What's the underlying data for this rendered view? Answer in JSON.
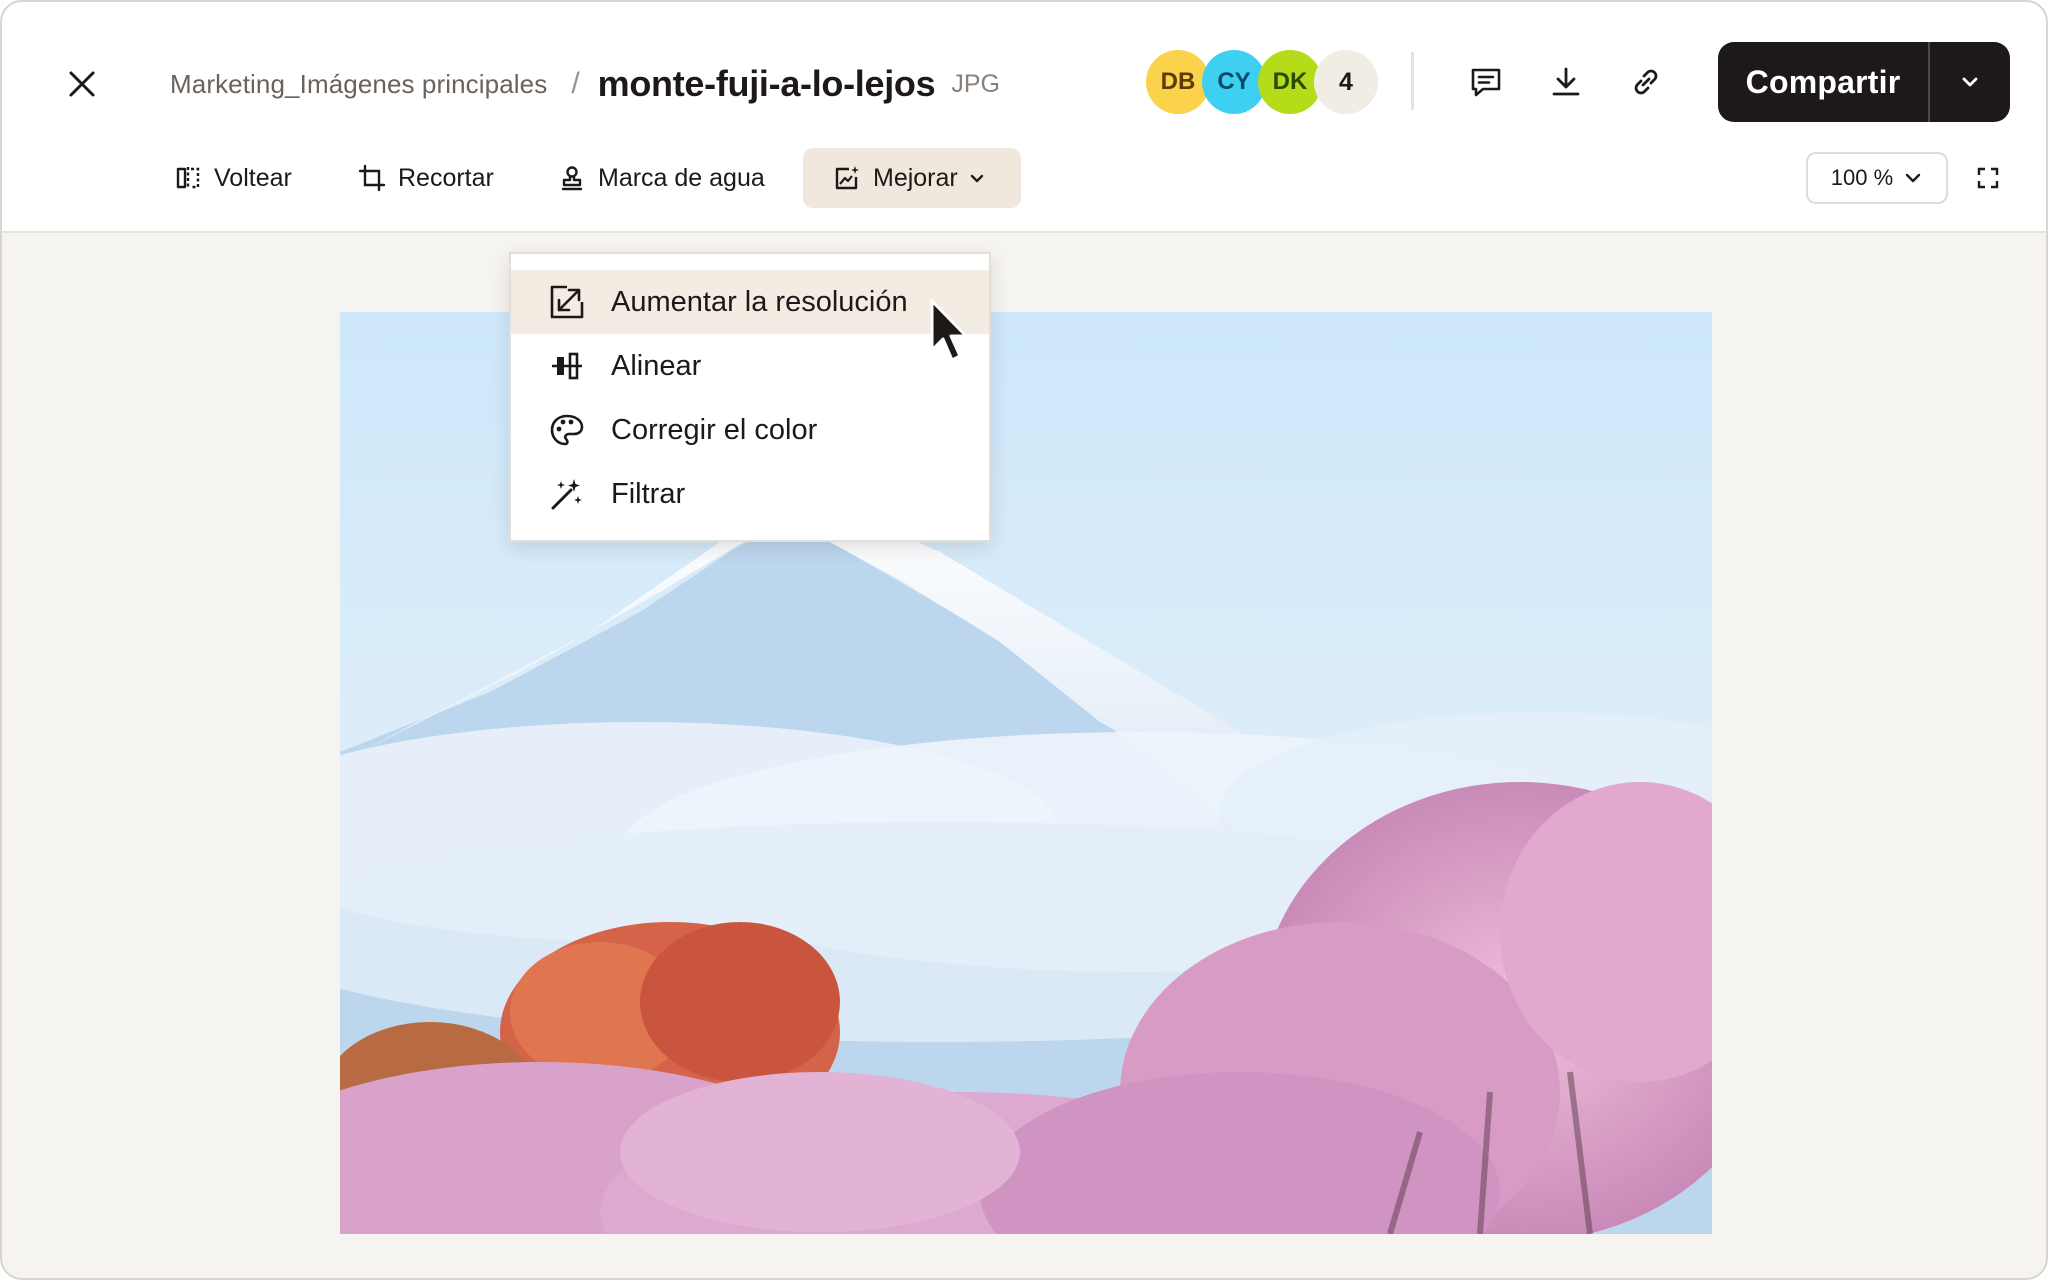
{
  "header": {
    "breadcrumb_folder": "Marketing_Imágenes principales",
    "breadcrumb_separator": "/",
    "file_name": "monte-fuji-a-lo-lejos",
    "file_type": "JPG",
    "collaborators": [
      {
        "initials": "DB",
        "color": "#fad24b"
      },
      {
        "initials": "CY",
        "color": "#3ed0f0"
      },
      {
        "initials": "DK",
        "color": "#b4dc19"
      }
    ],
    "collaborators_more": "4",
    "share_label": "Compartir"
  },
  "toolbar": {
    "flip_label": "Voltear",
    "crop_label": "Recortar",
    "watermark_label": "Marca de agua",
    "enhance_label": "Mejorar",
    "zoom_value": "100 %"
  },
  "enhance_menu": {
    "items": [
      {
        "label": "Aumentar la resolución",
        "icon": "upscale-icon",
        "hovered": true
      },
      {
        "label": "Alinear",
        "icon": "align-icon"
      },
      {
        "label": "Corregir el color",
        "icon": "palette-icon"
      },
      {
        "label": "Filtrar",
        "icon": "magic-wand-icon"
      }
    ]
  },
  "colors": {
    "primary_dark": "#1e1919",
    "active_tab_bg": "#f0e8dc",
    "canvas_bg": "#f6f4f0"
  }
}
